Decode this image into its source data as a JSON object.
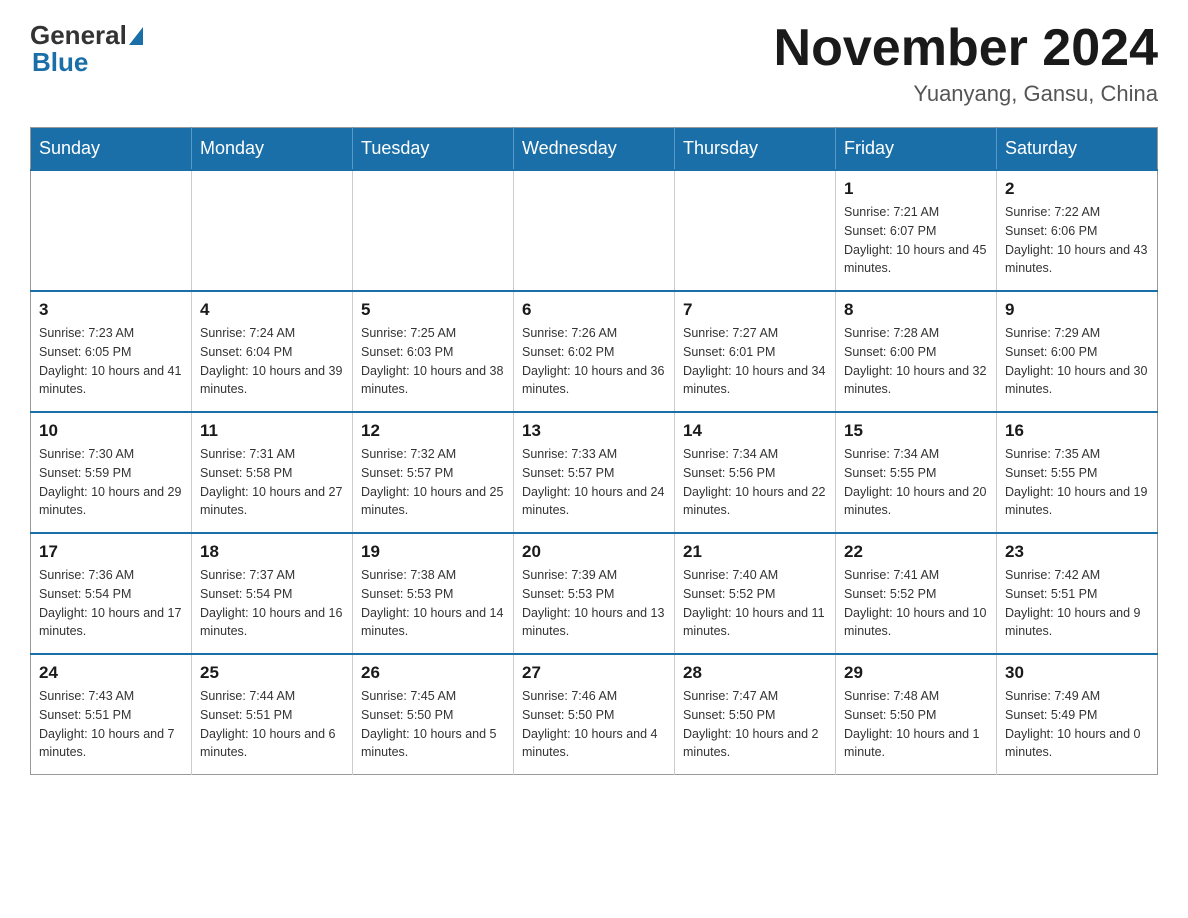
{
  "header": {
    "logo_general": "General",
    "logo_blue": "Blue",
    "month_title": "November 2024",
    "location": "Yuanyang, Gansu, China"
  },
  "weekdays": [
    "Sunday",
    "Monday",
    "Tuesday",
    "Wednesday",
    "Thursday",
    "Friday",
    "Saturday"
  ],
  "weeks": [
    [
      {
        "day": "",
        "info": ""
      },
      {
        "day": "",
        "info": ""
      },
      {
        "day": "",
        "info": ""
      },
      {
        "day": "",
        "info": ""
      },
      {
        "day": "",
        "info": ""
      },
      {
        "day": "1",
        "info": "Sunrise: 7:21 AM\nSunset: 6:07 PM\nDaylight: 10 hours and 45 minutes."
      },
      {
        "day": "2",
        "info": "Sunrise: 7:22 AM\nSunset: 6:06 PM\nDaylight: 10 hours and 43 minutes."
      }
    ],
    [
      {
        "day": "3",
        "info": "Sunrise: 7:23 AM\nSunset: 6:05 PM\nDaylight: 10 hours and 41 minutes."
      },
      {
        "day": "4",
        "info": "Sunrise: 7:24 AM\nSunset: 6:04 PM\nDaylight: 10 hours and 39 minutes."
      },
      {
        "day": "5",
        "info": "Sunrise: 7:25 AM\nSunset: 6:03 PM\nDaylight: 10 hours and 38 minutes."
      },
      {
        "day": "6",
        "info": "Sunrise: 7:26 AM\nSunset: 6:02 PM\nDaylight: 10 hours and 36 minutes."
      },
      {
        "day": "7",
        "info": "Sunrise: 7:27 AM\nSunset: 6:01 PM\nDaylight: 10 hours and 34 minutes."
      },
      {
        "day": "8",
        "info": "Sunrise: 7:28 AM\nSunset: 6:00 PM\nDaylight: 10 hours and 32 minutes."
      },
      {
        "day": "9",
        "info": "Sunrise: 7:29 AM\nSunset: 6:00 PM\nDaylight: 10 hours and 30 minutes."
      }
    ],
    [
      {
        "day": "10",
        "info": "Sunrise: 7:30 AM\nSunset: 5:59 PM\nDaylight: 10 hours and 29 minutes."
      },
      {
        "day": "11",
        "info": "Sunrise: 7:31 AM\nSunset: 5:58 PM\nDaylight: 10 hours and 27 minutes."
      },
      {
        "day": "12",
        "info": "Sunrise: 7:32 AM\nSunset: 5:57 PM\nDaylight: 10 hours and 25 minutes."
      },
      {
        "day": "13",
        "info": "Sunrise: 7:33 AM\nSunset: 5:57 PM\nDaylight: 10 hours and 24 minutes."
      },
      {
        "day": "14",
        "info": "Sunrise: 7:34 AM\nSunset: 5:56 PM\nDaylight: 10 hours and 22 minutes."
      },
      {
        "day": "15",
        "info": "Sunrise: 7:34 AM\nSunset: 5:55 PM\nDaylight: 10 hours and 20 minutes."
      },
      {
        "day": "16",
        "info": "Sunrise: 7:35 AM\nSunset: 5:55 PM\nDaylight: 10 hours and 19 minutes."
      }
    ],
    [
      {
        "day": "17",
        "info": "Sunrise: 7:36 AM\nSunset: 5:54 PM\nDaylight: 10 hours and 17 minutes."
      },
      {
        "day": "18",
        "info": "Sunrise: 7:37 AM\nSunset: 5:54 PM\nDaylight: 10 hours and 16 minutes."
      },
      {
        "day": "19",
        "info": "Sunrise: 7:38 AM\nSunset: 5:53 PM\nDaylight: 10 hours and 14 minutes."
      },
      {
        "day": "20",
        "info": "Sunrise: 7:39 AM\nSunset: 5:53 PM\nDaylight: 10 hours and 13 minutes."
      },
      {
        "day": "21",
        "info": "Sunrise: 7:40 AM\nSunset: 5:52 PM\nDaylight: 10 hours and 11 minutes."
      },
      {
        "day": "22",
        "info": "Sunrise: 7:41 AM\nSunset: 5:52 PM\nDaylight: 10 hours and 10 minutes."
      },
      {
        "day": "23",
        "info": "Sunrise: 7:42 AM\nSunset: 5:51 PM\nDaylight: 10 hours and 9 minutes."
      }
    ],
    [
      {
        "day": "24",
        "info": "Sunrise: 7:43 AM\nSunset: 5:51 PM\nDaylight: 10 hours and 7 minutes."
      },
      {
        "day": "25",
        "info": "Sunrise: 7:44 AM\nSunset: 5:51 PM\nDaylight: 10 hours and 6 minutes."
      },
      {
        "day": "26",
        "info": "Sunrise: 7:45 AM\nSunset: 5:50 PM\nDaylight: 10 hours and 5 minutes."
      },
      {
        "day": "27",
        "info": "Sunrise: 7:46 AM\nSunset: 5:50 PM\nDaylight: 10 hours and 4 minutes."
      },
      {
        "day": "28",
        "info": "Sunrise: 7:47 AM\nSunset: 5:50 PM\nDaylight: 10 hours and 2 minutes."
      },
      {
        "day": "29",
        "info": "Sunrise: 7:48 AM\nSunset: 5:50 PM\nDaylight: 10 hours and 1 minute."
      },
      {
        "day": "30",
        "info": "Sunrise: 7:49 AM\nSunset: 5:49 PM\nDaylight: 10 hours and 0 minutes."
      }
    ]
  ]
}
